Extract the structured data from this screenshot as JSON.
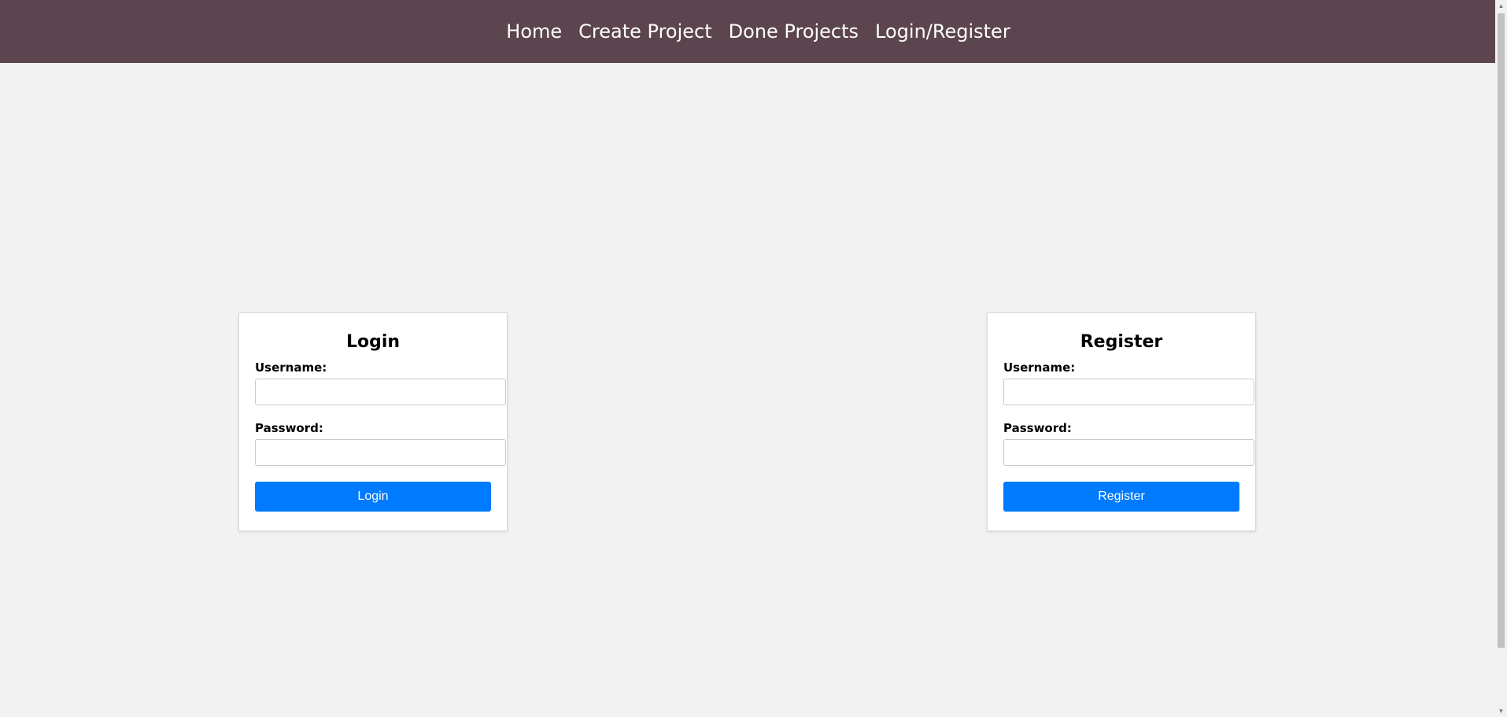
{
  "nav": {
    "items": [
      {
        "label": "Home"
      },
      {
        "label": "Create Project"
      },
      {
        "label": "Done Projects"
      },
      {
        "label": "Login/Register"
      }
    ]
  },
  "login": {
    "title": "Login",
    "username_label": "Username:",
    "username_value": "",
    "password_label": "Password:",
    "password_value": "",
    "button_label": "Login"
  },
  "register": {
    "title": "Register",
    "username_label": "Username:",
    "username_value": "",
    "password_label": "Password:",
    "password_value": "",
    "button_label": "Register"
  },
  "colors": {
    "header_bg": "#5c454e",
    "page_bg": "#f2f2f2",
    "button_bg": "#007bff",
    "button_text": "#ffffff"
  },
  "icons": {
    "scroll_up": "scroll-up-arrow-icon",
    "scroll_down": "scroll-down-arrow-icon"
  }
}
